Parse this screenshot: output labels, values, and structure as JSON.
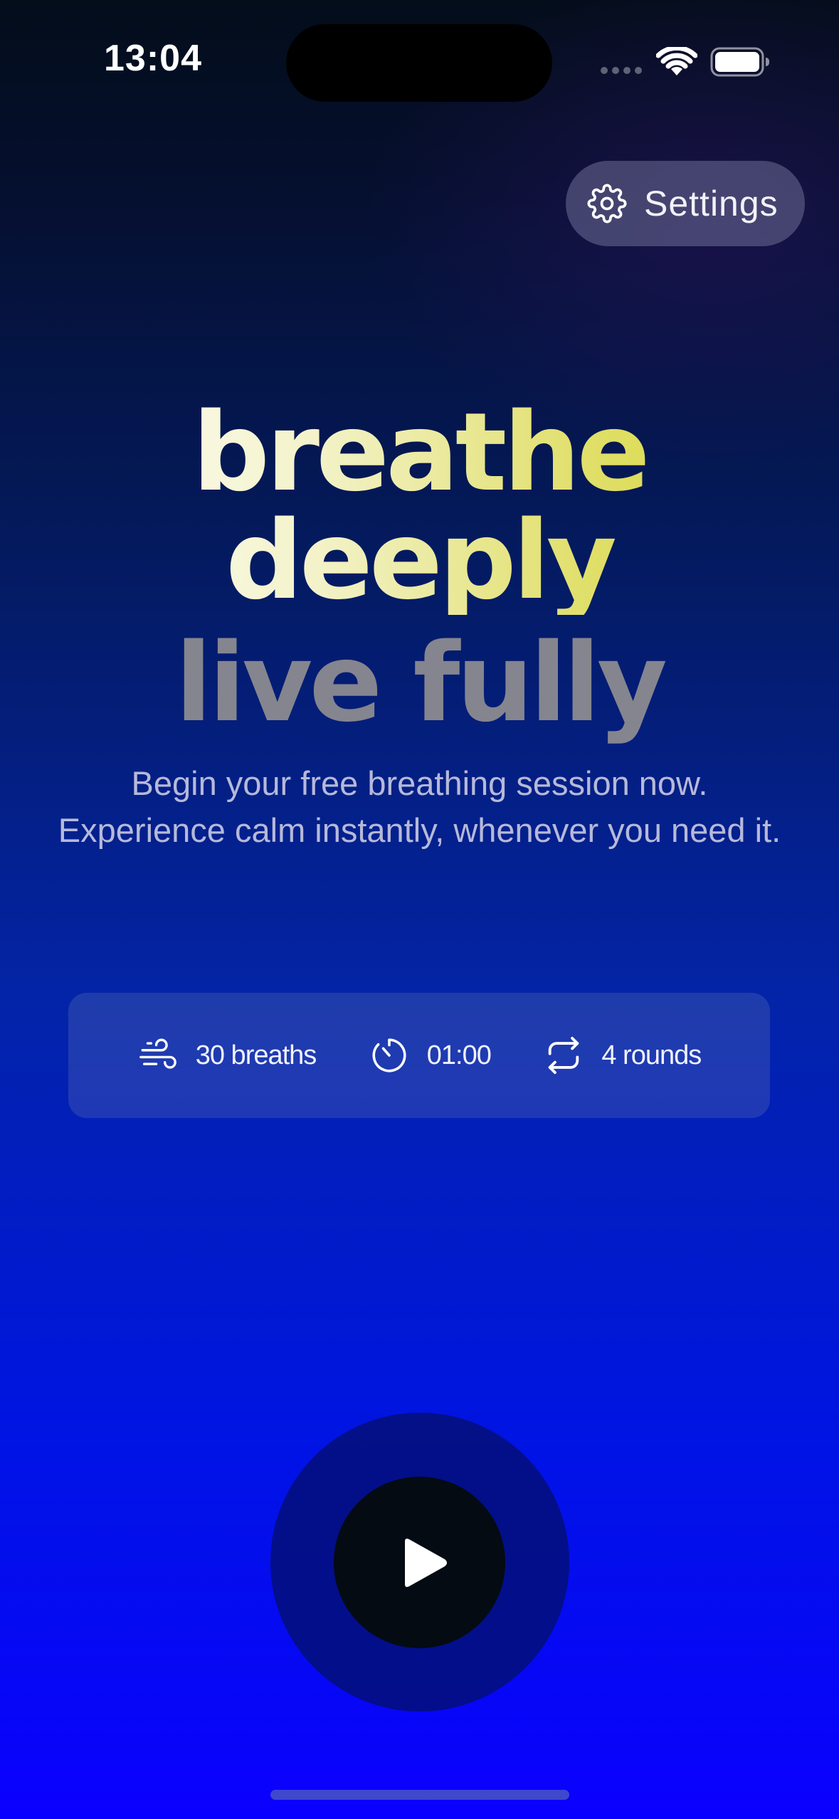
{
  "status_bar": {
    "time": "13:04"
  },
  "settings": {
    "label": "Settings",
    "icon": "gear-icon"
  },
  "headline": {
    "line1": "breathe deeply",
    "line2": "live fully"
  },
  "subtitle": {
    "line1": "Begin your free breathing session now.",
    "line2": "Experience calm instantly, whenever you need it."
  },
  "stats": [
    {
      "icon": "wind-icon",
      "label": "30 breaths"
    },
    {
      "icon": "timer-icon",
      "label": "01:00"
    },
    {
      "icon": "repeat-icon",
      "label": "4 rounds"
    }
  ],
  "play": {
    "icon": "play-icon"
  },
  "colors": {
    "headline_gradient_start": "#ffffff",
    "headline_gradient_end": "#d4d52a",
    "headline_line2": "#85858f",
    "background_top": "#040d1a",
    "background_bottom": "#0a00ff"
  }
}
